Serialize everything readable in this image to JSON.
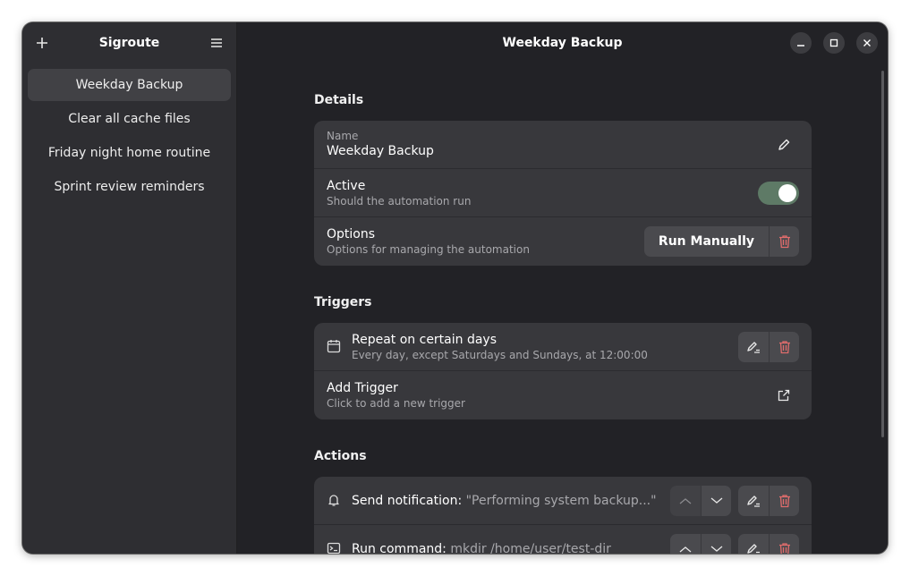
{
  "sidebar": {
    "title": "Sigroute",
    "items": [
      {
        "label": "Weekday Backup"
      },
      {
        "label": "Clear all cache files"
      },
      {
        "label": "Friday night home routine"
      },
      {
        "label": "Sprint review reminders"
      }
    ]
  },
  "header": {
    "title": "Weekday Backup"
  },
  "details": {
    "section_title": "Details",
    "name_caption": "Name",
    "name_value": "Weekday Backup",
    "active_title": "Active",
    "active_subtitle": "Should the automation run",
    "active_on": true,
    "options_title": "Options",
    "options_subtitle": "Options for managing the automation",
    "run_manually_label": "Run Manually"
  },
  "triggers": {
    "section_title": "Triggers",
    "items": [
      {
        "title": "Repeat on certain days",
        "subtitle": "Every day, except Saturdays and Sundays, at 12:00:00"
      }
    ],
    "add_title": "Add Trigger",
    "add_subtitle": "Click to add a new trigger"
  },
  "actions": {
    "section_title": "Actions",
    "items": [
      {
        "label": "Send notification:",
        "value": "\"Performing system backup...\""
      },
      {
        "label": "Run command:",
        "value": "mkdir /home/user/test-dir"
      }
    ]
  },
  "colors": {
    "accent_toggle": "#5e7a66",
    "destructive": "#e06c6c"
  }
}
